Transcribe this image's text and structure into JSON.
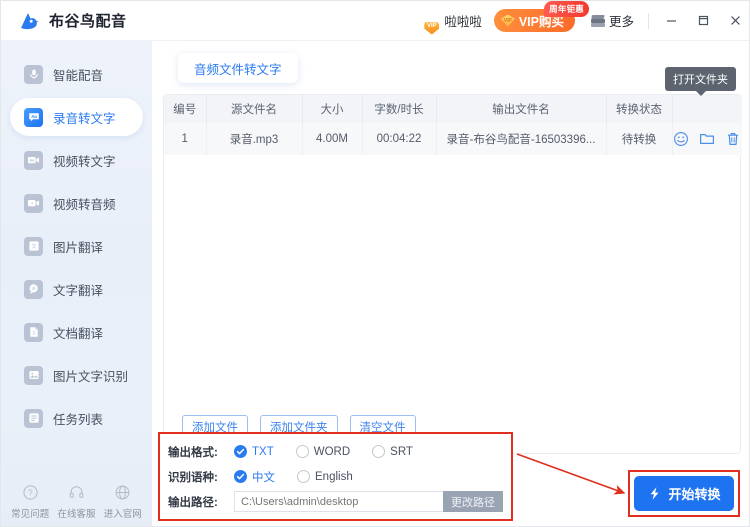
{
  "app": {
    "title": "布谷鸟配音",
    "logo_icon": "bird-logo-icon"
  },
  "titlebar": {
    "username": "啦啦啦",
    "avatar_badge": "VIP",
    "vip_button": "VIP购买",
    "vip_badge": "周年钜惠",
    "more_label": "更多",
    "minimize": "—",
    "maximize": "□",
    "close": "×"
  },
  "sidebar": {
    "items": [
      {
        "label": "智能配音",
        "icon": "mic-icon",
        "active": false
      },
      {
        "label": "录音转文字",
        "icon": "aa-speech-icon",
        "active": true
      },
      {
        "label": "视频转文字",
        "icon": "video-aa-icon",
        "active": false
      },
      {
        "label": "视频转音频",
        "icon": "video-audio-icon",
        "active": false
      },
      {
        "label": "图片翻译",
        "icon": "image-translate-icon",
        "active": false
      },
      {
        "label": "文字翻译",
        "icon": "text-translate-icon",
        "active": false
      },
      {
        "label": "文档翻译",
        "icon": "document-translate-icon",
        "active": false
      },
      {
        "label": "图片文字识别",
        "icon": "ocr-icon",
        "active": false
      },
      {
        "label": "任务列表",
        "icon": "task-list-icon",
        "active": false
      }
    ],
    "footer": [
      {
        "label": "常见问题",
        "icon": "question-circle-icon"
      },
      {
        "label": "在线客服",
        "icon": "headset-icon"
      },
      {
        "label": "进入官网",
        "icon": "globe-icon"
      }
    ]
  },
  "main": {
    "tab": "音频文件转文字",
    "table": {
      "headers": [
        "编号",
        "源文件名",
        "大小",
        "字数/时长",
        "输出文件名",
        "转换状态",
        ""
      ],
      "rows": [
        {
          "index": "1",
          "source_name": "录音.mp3",
          "size": "4.00M",
          "duration": "00:04:22",
          "output_name": "录音-布谷鸟配音-16503396...",
          "status": "待转换",
          "actions": [
            "preview-icon",
            "open-folder-icon",
            "delete-icon"
          ]
        }
      ],
      "tooltip": "打开文件夹"
    },
    "buttons": {
      "add_file": "添加文件",
      "add_folder": "添加文件夹",
      "clear_files": "清空文件"
    }
  },
  "settings": {
    "format_label": "输出格式:",
    "format_options": [
      {
        "label": "TXT",
        "selected": true
      },
      {
        "label": "WORD",
        "selected": false
      },
      {
        "label": "SRT",
        "selected": false
      }
    ],
    "language_label": "识别语种:",
    "language_options": [
      {
        "label": "中文",
        "selected": true
      },
      {
        "label": "English",
        "selected": false
      }
    ],
    "path_label": "输出路径:",
    "path_placeholder": "C:\\Users\\admin\\desktop",
    "path_value": "",
    "change_path_button": "更改路径"
  },
  "action": {
    "start_button": "开始转换",
    "start_icon": "lightning-bolt-icon"
  },
  "colors": {
    "accent_blue": "#2a7bf0",
    "start_blue": "#1e73f0",
    "annotation_red": "#e02f1e",
    "vip_orange": "#fb6a2a",
    "badge_red": "#f4372f"
  }
}
